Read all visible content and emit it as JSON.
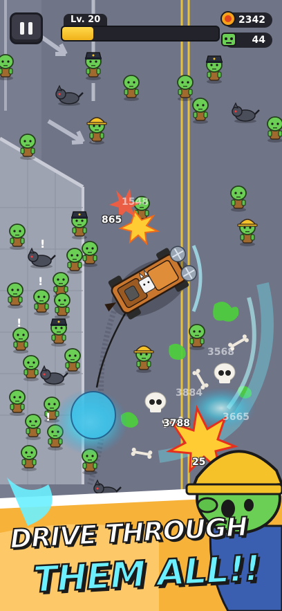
{
  "hud": {
    "level_label": "Lv. 20",
    "xp_progress": 0.2,
    "coins": "2342",
    "kills": "44",
    "icons": {
      "pause": "pause-icon",
      "coin": "coin-icon",
      "kills": "zombie-head-icon"
    }
  },
  "damage_numbers": [
    "1548",
    "865",
    "3568",
    "3884",
    "3788",
    "3665",
    "25"
  ],
  "banner": {
    "line1": "DRIVE THROUGH",
    "line2": "THEM ALL!!"
  },
  "colors": {
    "road": "#6f7487",
    "sidewalk": "#9ea3b2",
    "lane_line": "#e8c23a",
    "zombie_skin": "#5ec24a",
    "xp_fill": "#f6c22a",
    "banner_cyan": "#6cf0ff",
    "splash_green": "#4cd03c",
    "banner_orange": "#f7b23a"
  }
}
